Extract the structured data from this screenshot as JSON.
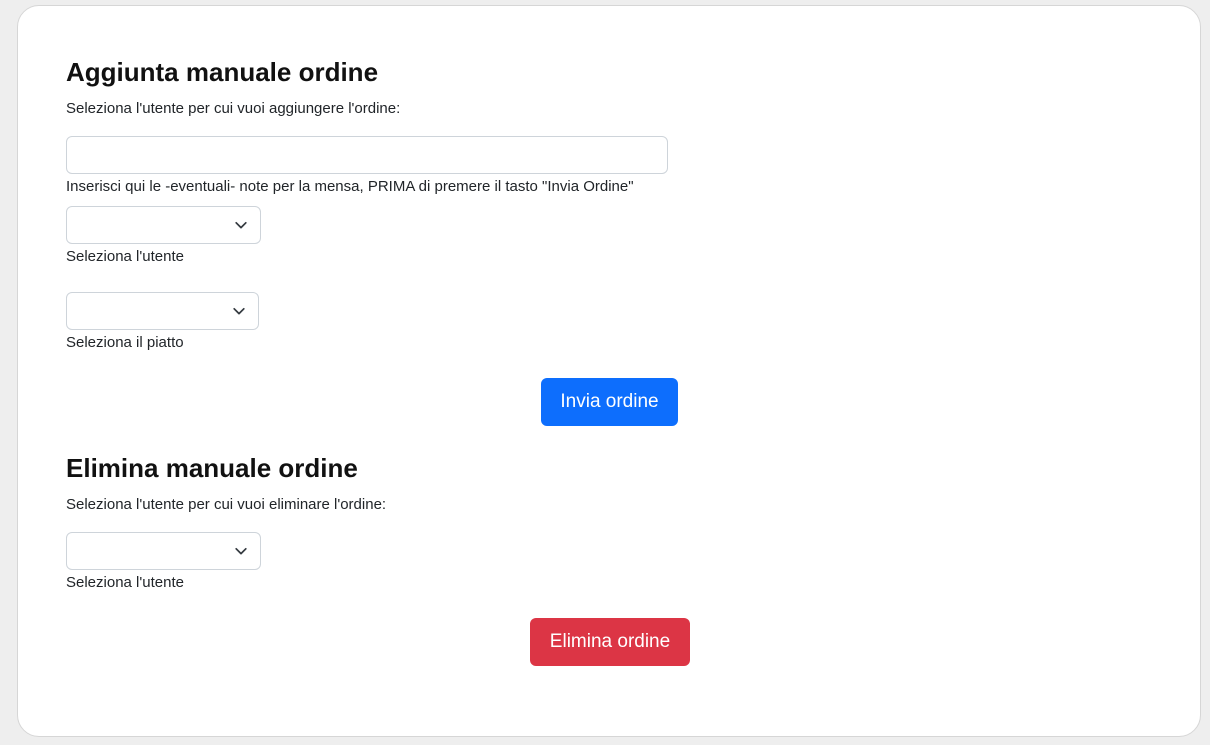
{
  "add_section": {
    "title": "Aggiunta manuale ordine",
    "instruction": "Seleziona l'utente per cui vuoi aggiungere l'ordine:",
    "notes_input_value": "",
    "notes_hint": "Inserisci qui le -eventuali- note per la mensa, PRIMA di premere il tasto \"Invia Ordine\"",
    "user_select_value": "",
    "user_select_label": "Seleziona l'utente",
    "dish_select_value": "",
    "dish_select_label": "Seleziona il piatto",
    "submit_label": "Invia ordine"
  },
  "delete_section": {
    "title": "Elimina manuale ordine",
    "instruction": "Seleziona l'utente per cui vuoi eliminare l'ordine:",
    "user_select_value": "",
    "user_select_label": "Seleziona l'utente",
    "delete_label": "Elimina ordine"
  },
  "colors": {
    "primary_button": "#0d6efd",
    "danger_button": "#dc3545",
    "page_background": "#eeeeee"
  },
  "icons": {
    "select_chevron": "chevron-down-icon"
  }
}
